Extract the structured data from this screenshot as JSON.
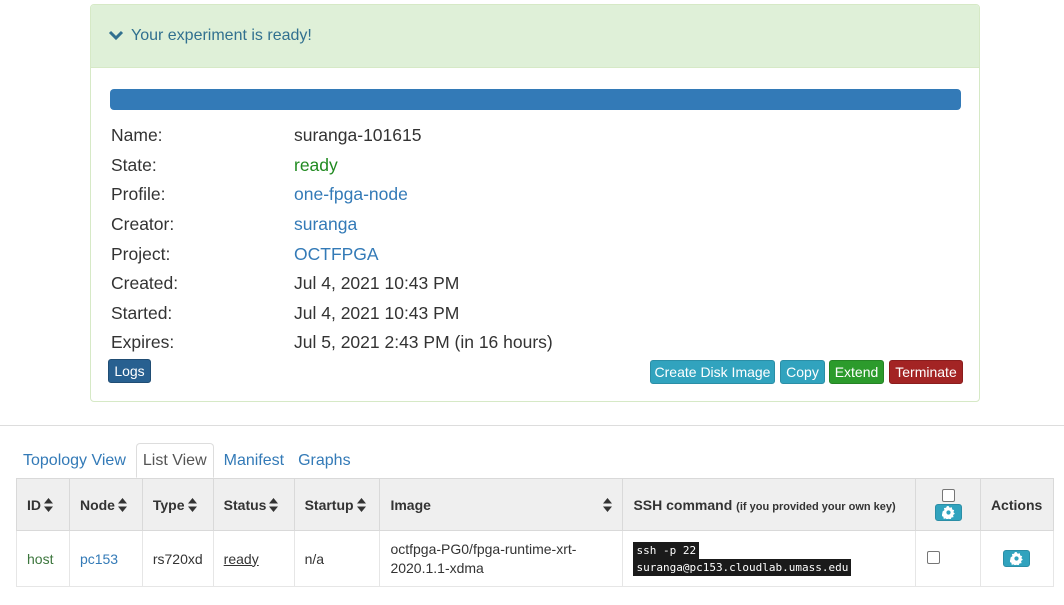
{
  "panel": {
    "heading": "Your experiment is ready!",
    "progress_percent": 100,
    "fields": [
      {
        "label": "Name:",
        "value": "suranga-101615",
        "kind": "text"
      },
      {
        "label": "State:",
        "value": "ready",
        "kind": "green"
      },
      {
        "label": "Profile:",
        "value": "one-fpga-node",
        "kind": "link"
      },
      {
        "label": "Creator:",
        "value": "suranga",
        "kind": "link"
      },
      {
        "label": "Project:",
        "value": "OCTFPGA",
        "kind": "link"
      },
      {
        "label": "Created:",
        "value": "Jul 4, 2021 10:43 PM",
        "kind": "text"
      },
      {
        "label": "Started:",
        "value": "Jul 4, 2021 10:43 PM",
        "kind": "text"
      },
      {
        "label": "Expires:",
        "value": "Jul 5, 2021 2:43 PM (in 16 hours)",
        "kind": "text"
      }
    ],
    "buttons": {
      "logs": "Logs",
      "create_disk_image": "Create Disk Image",
      "copy": "Copy",
      "extend": "Extend",
      "terminate": "Terminate"
    },
    "colors": {
      "heading_bg": "#dff0d8",
      "progress": "#337ab7",
      "terminate": "#a32424",
      "extend": "#2c9b2c",
      "info_btn": "#31a3be"
    }
  },
  "tabs": [
    {
      "label": "Topology View",
      "active": false
    },
    {
      "label": "List View",
      "active": true
    },
    {
      "label": "Manifest",
      "active": false
    },
    {
      "label": "Graphs",
      "active": false
    }
  ],
  "table": {
    "headers": {
      "id": "ID",
      "node": "Node",
      "type": "Type",
      "status": "Status",
      "startup": "Startup",
      "image": "Image",
      "ssh": "SSH command",
      "ssh_note": "(if you provided your own key)",
      "actions": "Actions"
    },
    "rows": [
      {
        "id": "host",
        "node": "pc153",
        "type": "rs720xd",
        "status": "ready",
        "startup": "n/a",
        "image": "octfpga-PG0/fpga-runtime-xrt-2020.1.1-xdma",
        "ssh_line1": "ssh -p 22",
        "ssh_line2": "suranga@pc153.cloudlab.umass.edu"
      }
    ]
  }
}
